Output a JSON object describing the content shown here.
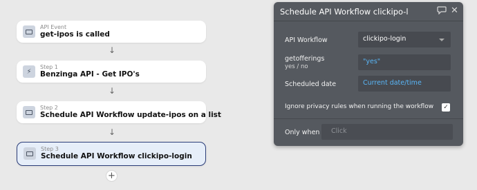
{
  "workflow": {
    "event": {
      "sub": "API Event",
      "title": "get-ipos is called"
    },
    "steps": [
      {
        "sub": "Step 1",
        "title": "Benzinga API - Get IPO's"
      },
      {
        "sub": "Step 2",
        "title": "Schedule API Workflow update-ipos on a list"
      },
      {
        "sub": "Step 3",
        "title": "Schedule API Workflow clickipo-login"
      }
    ],
    "add_glyph": "+"
  },
  "panel": {
    "title": "Schedule API Workflow clickipo-l",
    "comment_icon": "comment-icon",
    "close_icon": "close-icon",
    "api_workflow": {
      "label": "API Workflow",
      "value": "clickipo-login"
    },
    "getofferings": {
      "label": "getofferings",
      "sublabel": "yes / no",
      "value": "\"yes\""
    },
    "scheduled_date": {
      "label": "Scheduled date",
      "value": "Current date/time"
    },
    "ignore_privacy": {
      "label": "Ignore privacy rules when running the workflow",
      "checked": true
    },
    "only_when": {
      "label": "Only when",
      "placeholder": "Click"
    }
  },
  "colors": {
    "panel_bg": "#55595f",
    "selected_border": "#2a3c78",
    "selected_bg": "#e6eef9",
    "dynamic_value": "#59b6f7"
  }
}
